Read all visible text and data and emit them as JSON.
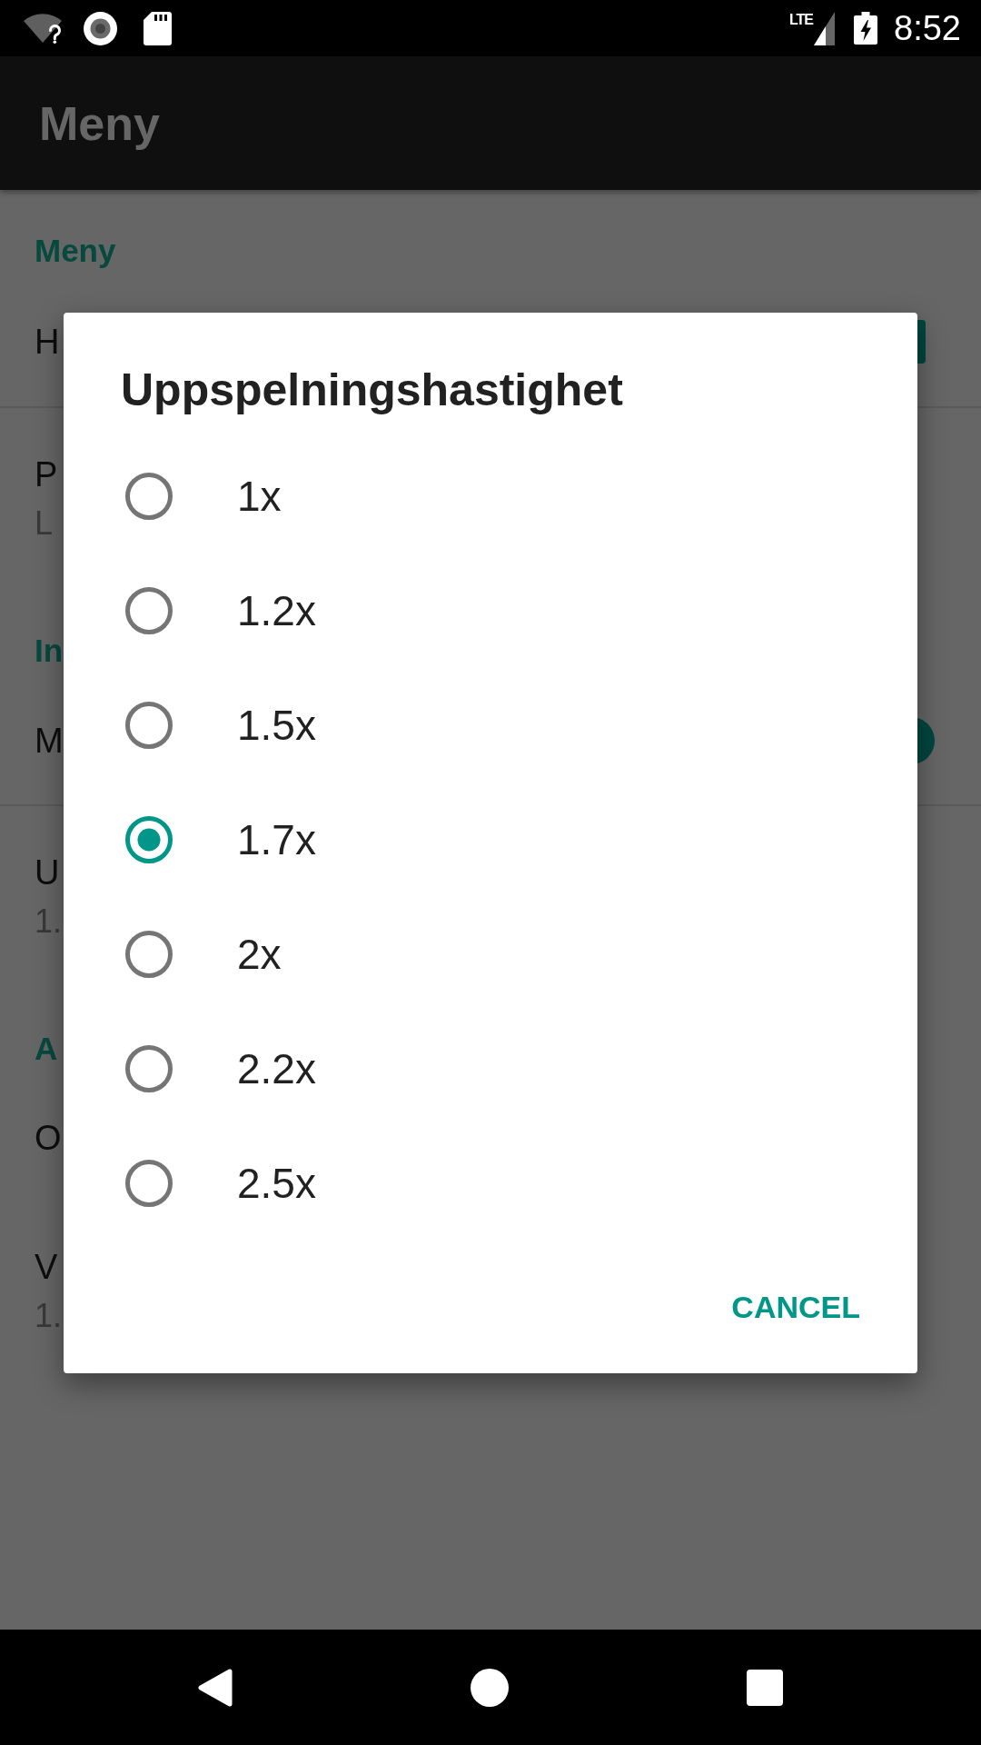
{
  "status_bar": {
    "network": "LTE",
    "time": "8:52"
  },
  "app_bar": {
    "title": "Meny"
  },
  "settings": [
    {
      "kind": "category",
      "title": "Meny"
    },
    {
      "kind": "checkbox",
      "title": "H",
      "checked": true
    },
    {
      "kind": "divider"
    },
    {
      "kind": "text",
      "title": "P",
      "summary": "L"
    },
    {
      "kind": "category",
      "title": "In"
    },
    {
      "kind": "switch",
      "title": "M",
      "on": true
    },
    {
      "kind": "divider"
    },
    {
      "kind": "text",
      "title": "U",
      "summary": "1."
    },
    {
      "kind": "category",
      "title": "A"
    },
    {
      "kind": "text",
      "title": "O"
    },
    {
      "kind": "text",
      "title": "V",
      "summary": "1."
    }
  ],
  "dialog": {
    "title": "Uppspelningshastighet",
    "options": [
      {
        "label": "1x",
        "selected": false
      },
      {
        "label": "1.2x",
        "selected": false
      },
      {
        "label": "1.5x",
        "selected": false
      },
      {
        "label": "1.7x",
        "selected": true
      },
      {
        "label": "2x",
        "selected": false
      },
      {
        "label": "2.2x",
        "selected": false
      },
      {
        "label": "2.5x",
        "selected": false
      }
    ],
    "buttons": [
      {
        "label": "CANCEL"
      }
    ]
  }
}
